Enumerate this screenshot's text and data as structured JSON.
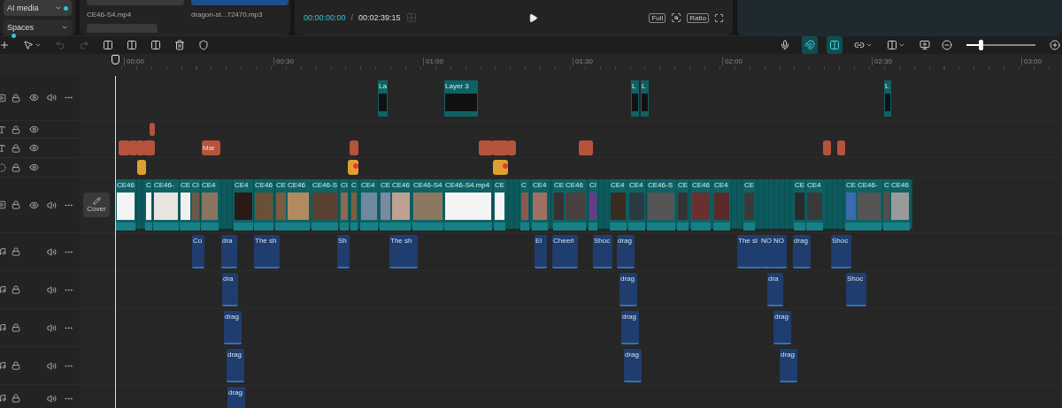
{
  "side_menu": [
    {
      "label": "AI media",
      "selected": true
    },
    {
      "label": "Spaces",
      "selected": false
    }
  ],
  "media": [
    {
      "name": "CE46-S4.mp4",
      "kind": "video"
    },
    {
      "name": "dragon-st...72470.mp3",
      "kind": "audio"
    }
  ],
  "player": {
    "current_time": "00:00:00:00",
    "separator": "/",
    "duration": "00:02:39:15",
    "buttons": [
      "Full",
      "Ratio"
    ]
  },
  "toolbar": {
    "left": [
      {
        "kind": "add",
        "disabled": false
      },
      {
        "kind": "select",
        "disabled": false
      },
      {
        "kind": "undo",
        "disabled": true
      },
      {
        "kind": "redo",
        "disabled": true
      },
      {
        "kind": "split",
        "disabled": false
      },
      {
        "kind": "split-left",
        "disabled": false
      },
      {
        "kind": "split-right",
        "disabled": false
      },
      {
        "kind": "delete",
        "disabled": false
      },
      {
        "kind": "marker",
        "disabled": false
      }
    ],
    "right": [
      {
        "kind": "mic",
        "on": false
      },
      {
        "kind": "magnet",
        "on": true
      },
      {
        "kind": "snap",
        "on": true
      },
      {
        "kind": "link",
        "on": false
      },
      {
        "kind": "preview",
        "on": false
      },
      {
        "kind": "monitor",
        "on": false
      }
    ],
    "zoom": {
      "level": 0.2
    }
  },
  "ruler": [
    "00:00",
    "00:30",
    "01:00",
    "01:30",
    "02:00",
    "02:30",
    "03:00"
  ],
  "cover_button": "Cover",
  "tracks": [
    {
      "kind": "overlay",
      "clips": [
        "La",
        "Layer 3",
        "L",
        "L",
        "L"
      ]
    },
    {
      "kind": "text"
    },
    {
      "kind": "text",
      "clips": [
        "Mar"
      ]
    },
    {
      "kind": "effect"
    },
    {
      "kind": "main",
      "clips": [
        "CE46",
        "C",
        "CE46-",
        "CE",
        "CI",
        "CE4",
        "CE4",
        "CE46",
        "CE",
        "CE46",
        "CE46-S",
        "CI",
        "C",
        "CE4",
        "CE",
        "CE46",
        "CE46-S4",
        "CE46-S4.mp4",
        "CE",
        "C",
        "CE4",
        "CE",
        "CE46",
        "CI",
        "CE4",
        "CE4",
        "CE46-S",
        "CE",
        "CE46",
        "CE4",
        "CE",
        "CE",
        "CE4",
        "CE",
        "CE46-",
        "C",
        "CE46"
      ]
    },
    {
      "kind": "audio",
      "clips": [
        "Co",
        "dra",
        "The sh",
        "Sh",
        "The sh",
        "El",
        "Cheeri",
        "Shoc",
        "drag",
        "The sl",
        "NO",
        "NO",
        "drag",
        "Shoc"
      ]
    },
    {
      "kind": "audio",
      "clips": [
        "dra",
        "drag",
        "dra",
        "Shoc"
      ]
    },
    {
      "kind": "audio",
      "clips": [
        "drag",
        "drag",
        "drag"
      ]
    },
    {
      "kind": "audio",
      "clips": [
        "drag",
        "drag",
        "drag"
      ]
    },
    {
      "kind": "audio",
      "clips": [
        "drag"
      ]
    }
  ]
}
